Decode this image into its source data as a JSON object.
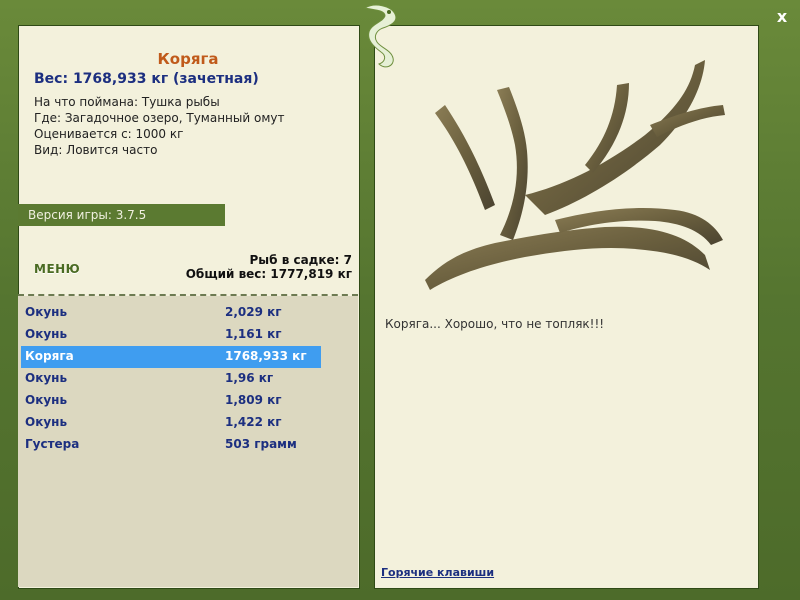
{
  "close_label": "x",
  "fish": {
    "title": "Коряга",
    "weight": "Вес: 1768,933 кг (зачетная)",
    "caught_on": "На что поймана: Тушка рыбы",
    "where": "Где: Загадочное озеро, Туманный омут",
    "rated_from": "Оценивается с: 1000 кг",
    "kind": "Вид: Ловится часто",
    "comment": "Коряга... Хорошо, что не топляк!!!"
  },
  "version": "Версия игры: 3.7.5",
  "menu_label": "МЕНЮ",
  "keepnet": {
    "count": "Рыб в садке: 7",
    "total_weight": "Общий вес: 1777,819 кг"
  },
  "catch_list": [
    {
      "name": "Окунь",
      "weight": "2,029 кг",
      "selected": false
    },
    {
      "name": "Окунь",
      "weight": "1,161 кг",
      "selected": false
    },
    {
      "name": "Коряга",
      "weight": "1768,933 кг",
      "selected": true
    },
    {
      "name": "Окунь",
      "weight": "1,96 кг",
      "selected": false
    },
    {
      "name": "Окунь",
      "weight": "1,809 кг",
      "selected": false
    },
    {
      "name": "Окунь",
      "weight": "1,422 кг",
      "selected": false
    },
    {
      "name": "Густера",
      "weight": "503 грамм",
      "selected": false
    }
  ],
  "hotkeys_label": "Горячие клавиши"
}
